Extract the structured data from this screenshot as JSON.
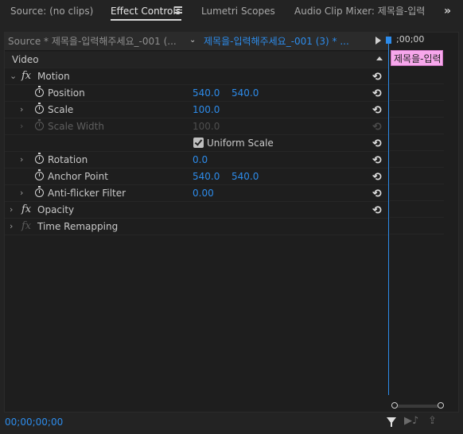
{
  "tabs": [
    {
      "label": "Source: (no clips)"
    },
    {
      "label": "Effect Controls"
    },
    {
      "label": "Lumetri Scopes"
    },
    {
      "label": "Audio Clip Mixer: 제목을-입력"
    }
  ],
  "overflow_glyph": "»",
  "header": {
    "source_label": "Source * 제목을-입력해주세요_-001 (...",
    "sequence_label": "제목을-입력해주세요_-001 (3) * ...",
    "chevron": "⌄"
  },
  "timeline": {
    "time_label": ";00;00",
    "clip_label": "제목을-입력"
  },
  "section_label": "Video",
  "fx_glyph": "fx",
  "reset_glyph": "⟲",
  "twirl_right": "›",
  "twirl_down": "⌄",
  "effects": {
    "motion": {
      "name": "Motion",
      "position": {
        "label": "Position",
        "x": "540.0",
        "y": "540.0"
      },
      "scale": {
        "label": "Scale",
        "value": "100.0"
      },
      "scale_width": {
        "label": "Scale Width",
        "value": "100.0"
      },
      "uniform_scale": {
        "label": "Uniform Scale",
        "checked": true
      },
      "rotation": {
        "label": "Rotation",
        "value": "0.0"
      },
      "anchor_point": {
        "label": "Anchor Point",
        "x": "540.0",
        "y": "540.0"
      },
      "anti_flicker": {
        "label": "Anti-flicker Filter",
        "value": "0.00"
      }
    },
    "opacity": {
      "name": "Opacity"
    },
    "time_remapping": {
      "name": "Time Remapping"
    }
  },
  "footer": {
    "timecode": "00;00;00;00",
    "play_audio_glyph": "▶♪",
    "export_glyph": "⇪"
  },
  "colors": {
    "accent": "#2d8ceb",
    "clip": "#f7a7ec",
    "background": "#1e1e1e"
  }
}
